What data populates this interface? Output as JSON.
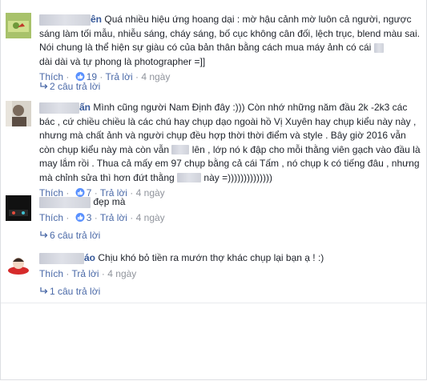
{
  "comments": [
    {
      "name_visible": "ên",
      "text": "Quá nhiều hiệu ứng hoang dại : mờ hậu cảnh mờ luôn cả người, ngược sáng làm tối mẫu, nhiễu sáng, cháy sáng, bố cục không cân đối, lệch trục, blend màu sai. Nói chung là thể hiện sự giàu có của bản thân bằng cách mua máy ảnh có cái",
      "text_end": "dài dài và tự phong là photographer =]]",
      "like_label": "Thích",
      "like_count": "19",
      "reply_label": "Trả lời",
      "time": "4 ngày",
      "replies": "2 câu trả lời"
    },
    {
      "name_visible": "ấn",
      "text_a": "Mình cũng người Nam Định đây :))) Còn nhớ những năm đầu 2k -2k3 các bác , cứ chiều chiều là các chú hay chụp dạo ngoài hồ Vị Xuyên hay chụp kiểu này này , nhưng mà chất ảnh và người chụp đều hợp thời thời điểm và style . Bây giờ 2016 vẫn còn chụp kiểu này mà còn vẫn",
      "text_b": "lên , lớp nó k đập cho mỗi thằng viên gạch vào đầu là may lắm rồi . Thua cả mấy em 97 chụp bằng cả cái Tấm , nó chụp k có tiếng đâu , nhưng mà chỉnh sửa thì hơn đứt thằng",
      "text_c": "này =))))))))))))))",
      "like_label": "Thích",
      "like_count": "7",
      "reply_label": "Trả lời",
      "time": "4 ngày",
      "replies": ""
    },
    {
      "name_visible": "",
      "text": "đẹp mà",
      "like_label": "Thích",
      "like_count": "3",
      "reply_label": "Trả lời",
      "time": "4 ngày",
      "replies": "6 câu trả lời"
    },
    {
      "name_visible": "áo",
      "text": "Chịu khó bỏ tiền ra mướn thợ khác chụp lại bạn ạ ! :)",
      "like_label": "Thích",
      "like_count": "",
      "reply_label": "Trả lời",
      "time": "4 ngày",
      "replies": "1 câu trả lời"
    }
  ],
  "colors": {
    "link": "#365899",
    "meta": "#90949c",
    "like_blue": "#5890ff"
  }
}
